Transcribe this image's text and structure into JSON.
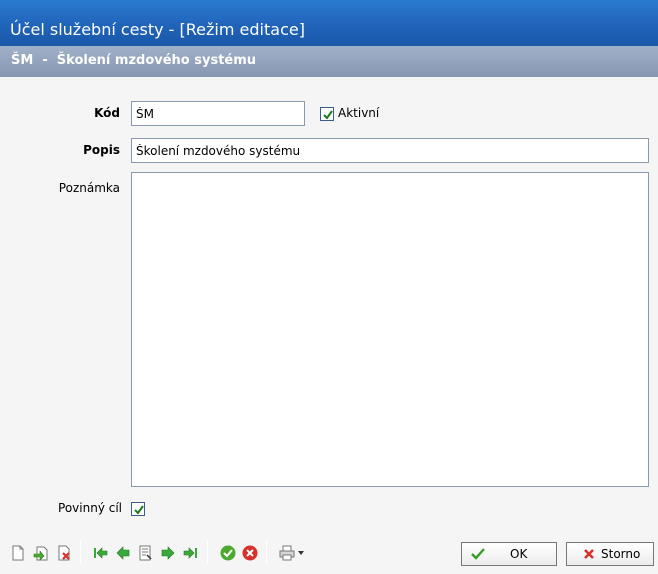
{
  "window": {
    "title": "Účel služební cesty - [Režim editace]",
    "subtitle": "ŠM  -  Školení mzdového systému"
  },
  "form": {
    "kod_label": "Kód",
    "kod_value": "ŠM",
    "aktivni_label": "Aktivní",
    "aktivni_checked": true,
    "popis_label": "Popis",
    "popis_value": "Školení mzdového systému",
    "poznamka_label": "Poznámka",
    "poznamka_value": "",
    "povinny_label": "Povinný cíl",
    "povinny_checked": true
  },
  "toolbar": {
    "icons": [
      "new-icon",
      "edit-icon",
      "delete-icon",
      "first-record-icon",
      "previous-record-icon",
      "record-list-icon",
      "next-record-icon",
      "last-record-icon",
      "confirm-icon",
      "cancel-icon",
      "print-icon"
    ],
    "ok_label": "OK",
    "storno_label": "Storno"
  },
  "colors": {
    "title_bar": "#1f62b8",
    "sub_bar": "#8797b2",
    "nav_arrow": "#3aa83a",
    "confirm": "#4caa2e",
    "cancel": "#d8302a"
  }
}
